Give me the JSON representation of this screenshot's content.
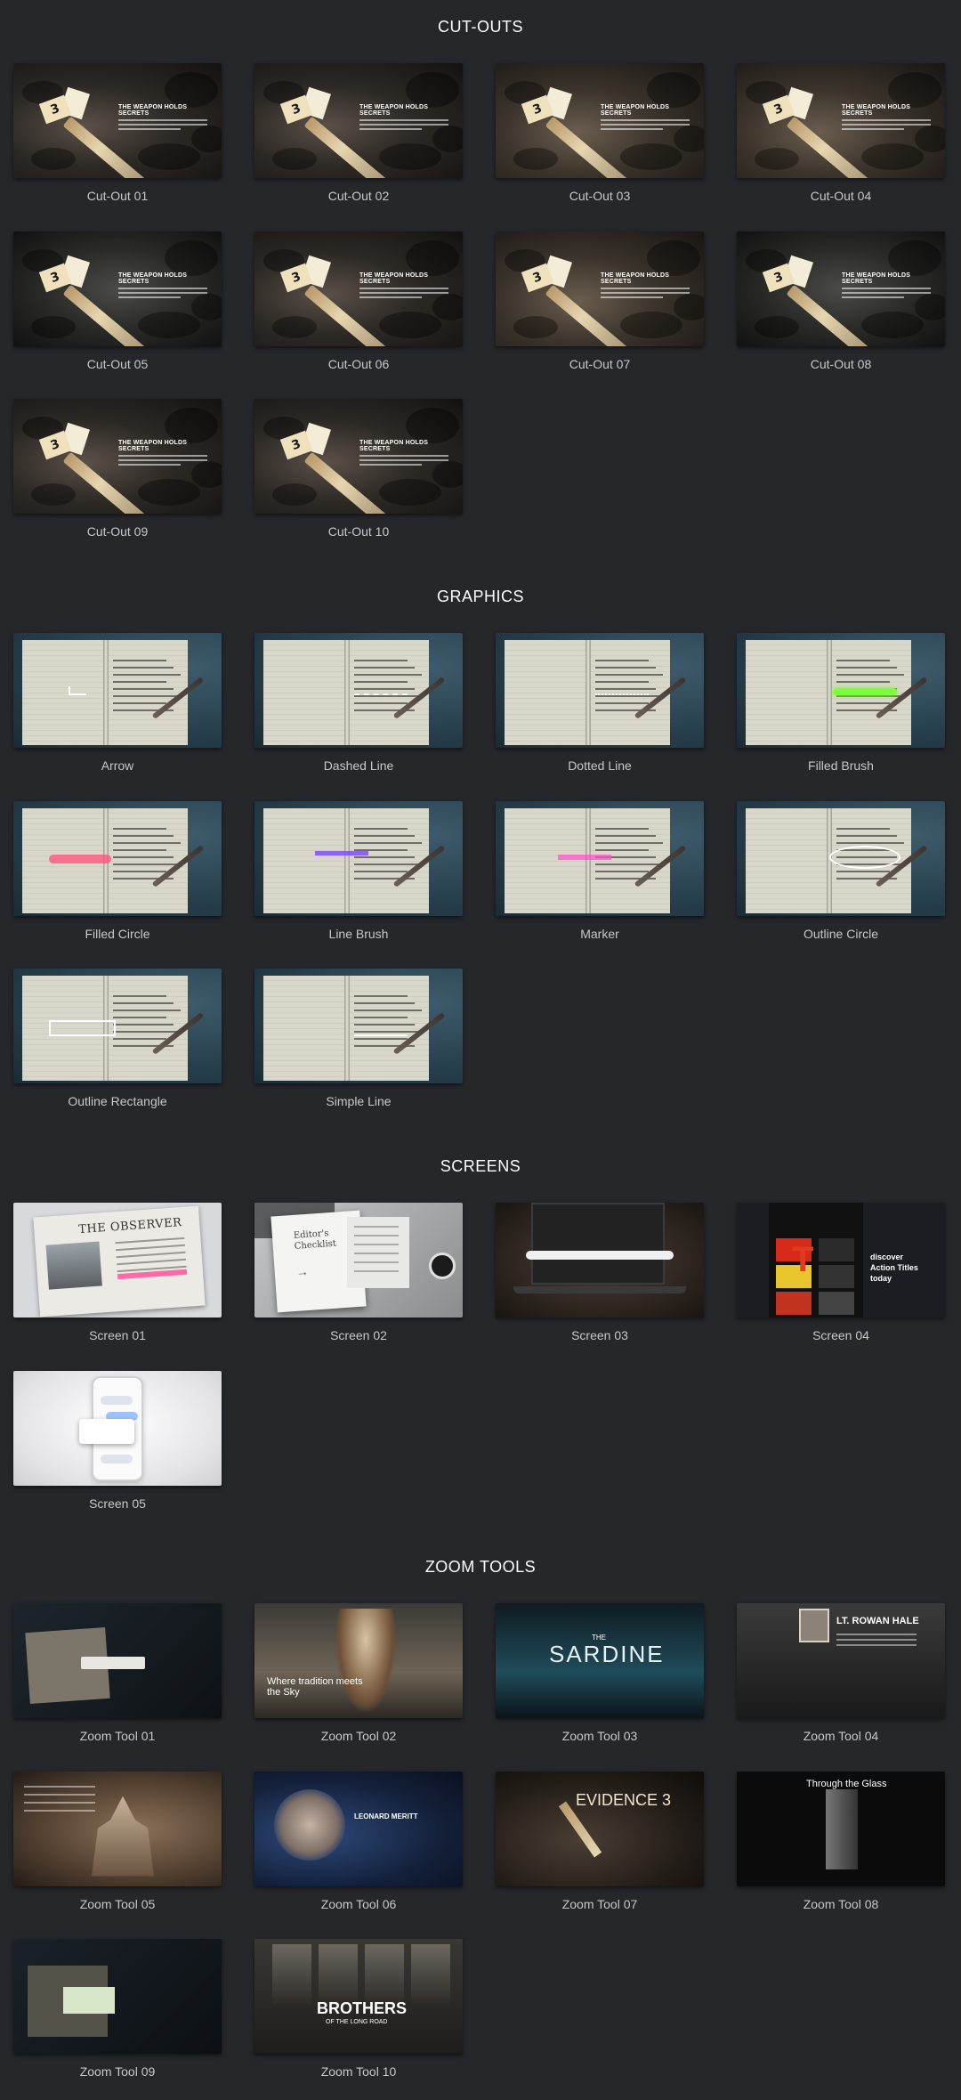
{
  "sections": [
    {
      "title": "CUT-OUTS",
      "items": [
        "Cut-Out 01",
        "Cut-Out 02",
        "Cut-Out 03",
        "Cut-Out 04",
        "Cut-Out 05",
        "Cut-Out 06",
        "Cut-Out 07",
        "Cut-Out 08",
        "Cut-Out 09",
        "Cut-Out 10"
      ]
    },
    {
      "title": "GRAPHICS",
      "items": [
        "Arrow",
        "Dashed Line",
        "Dotted Line",
        "Filled Brush",
        "Filled Circle",
        "Line Brush",
        "Marker",
        "Outline Circle",
        "Outline Rectangle",
        "Simple Line"
      ]
    },
    {
      "title": "SCREENS",
      "items": [
        "Screen 01",
        "Screen 02",
        "Screen 03",
        "Screen 04",
        "Screen 05"
      ]
    },
    {
      "title": "ZOOM TOOLS",
      "items": [
        "Zoom Tool 01",
        "Zoom Tool 02",
        "Zoom Tool 03",
        "Zoom Tool 04",
        "Zoom Tool 05",
        "Zoom Tool 06",
        "Zoom Tool 07",
        "Zoom Tool 08",
        "Zoom Tool 09",
        "Zoom Tool 10"
      ]
    }
  ],
  "thumb_text": {
    "cutout_heading": "THE WEAPON HOLDS SECRETS",
    "evidence_tag": "3",
    "observer_masthead": "THE OBSERVER",
    "editor_checklist": "Editor's Checklist",
    "screen4_line1": "discover",
    "screen4_line2": "Action Titles",
    "screen4_line3": "today",
    "screen4_tile": "T",
    "zoom2_caption": "Where tradition meets the Sky",
    "zoom3_title": "SARDINE",
    "zoom3_the": "THE",
    "zoom4_title": "LT. ROWAN HALE",
    "zoom6_name": "LEONARD MERITT",
    "zoom7_title": "EVIDENCE 3",
    "zoom8_title": "Through the Glass",
    "zoom10_title": "BROTHERS",
    "zoom10_sub": "OF THE LONG ROAD"
  },
  "colors": {
    "background": "#25272b",
    "section_title": "#ffffff",
    "label": "#c8c8c8",
    "filled_brush": "#7cff3a",
    "filled_circle": "#ff4f7a",
    "line_brush": "#7a45ff",
    "marker": "#ff4fd0"
  }
}
